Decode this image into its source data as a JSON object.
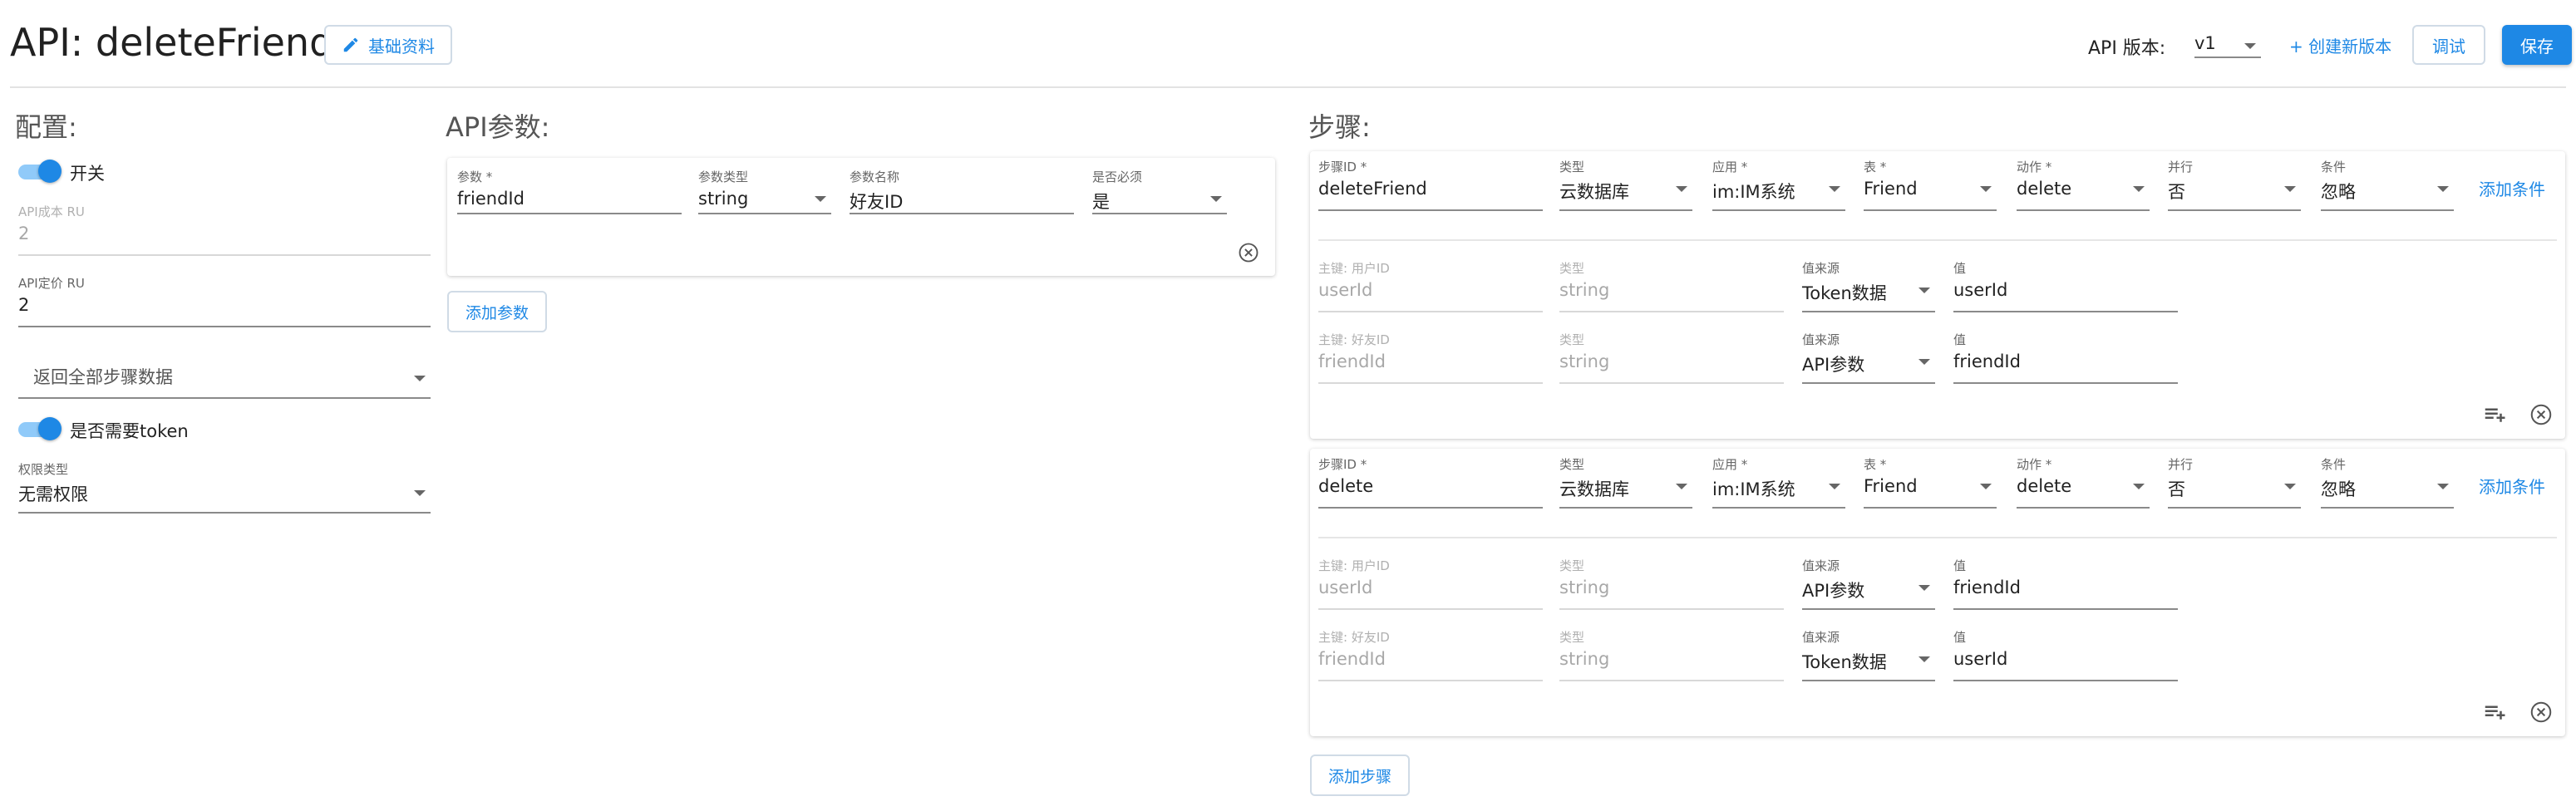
{
  "header": {
    "title": "API: deleteFriend",
    "basic_info_label": "基础资料",
    "api_version_label": "API 版本:",
    "api_version_value": "v1",
    "create_version_label": "+ 创建新版本",
    "debug_label": "调试",
    "save_label": "保存"
  },
  "config": {
    "heading": "配置:",
    "switch_label": "开关",
    "api_cost_label": "API成本 RU",
    "api_cost_value": "2",
    "api_price_label": "API定价 RU",
    "api_price_value": "2",
    "return_select_placeholder": "返回全部步骤数据",
    "token_label": "是否需要token",
    "permission_label": "权限类型",
    "permission_value": "无需权限"
  },
  "params": {
    "heading": "API参数:",
    "items": [
      {
        "param_label": "参数 *",
        "param_value": "friendId",
        "type_label": "参数类型",
        "type_value": "string",
        "name_label": "参数名称",
        "name_value": "好友ID",
        "required_label": "是否必须",
        "required_value": "是"
      }
    ],
    "add_label": "添加参数"
  },
  "steps": {
    "heading": "步骤:",
    "items": [
      {
        "step_id_label": "步骤ID *",
        "step_id_value": "deleteFriend",
        "type_label": "类型",
        "type_value": "云数据库",
        "app_label": "应用 *",
        "app_value": "im:IM系统",
        "table_label": "表 *",
        "table_value": "Friend",
        "action_label": "动作 *",
        "action_value": "delete",
        "parallel_label": "并行",
        "parallel_value": "否",
        "condition_label": "条件",
        "condition_value": "忽略",
        "add_condition_label": "添加条件",
        "keys": [
          {
            "key_label": "主键: 用户ID",
            "key_value": "userId",
            "ktype_label": "类型",
            "ktype_value": "string",
            "source_label": "值来源",
            "source_value": "Token数据",
            "value_label": "值",
            "value_value": "userId"
          },
          {
            "key_label": "主键: 好友ID",
            "key_value": "friendId",
            "ktype_label": "类型",
            "ktype_value": "string",
            "source_label": "值来源",
            "source_value": "API参数",
            "value_label": "值",
            "value_value": "friendId"
          }
        ]
      },
      {
        "step_id_label": "步骤ID *",
        "step_id_value": "delete",
        "type_label": "类型",
        "type_value": "云数据库",
        "app_label": "应用 *",
        "app_value": "im:IM系统",
        "table_label": "表 *",
        "table_value": "Friend",
        "action_label": "动作 *",
        "action_value": "delete",
        "parallel_label": "并行",
        "parallel_value": "否",
        "condition_label": "条件",
        "condition_value": "忽略",
        "add_condition_label": "添加条件",
        "keys": [
          {
            "key_label": "主键: 用户ID",
            "key_value": "userId",
            "ktype_label": "类型",
            "ktype_value": "string",
            "source_label": "值来源",
            "source_value": "API参数",
            "value_label": "值",
            "value_value": "friendId"
          },
          {
            "key_label": "主键: 好友ID",
            "key_value": "friendId",
            "ktype_label": "类型",
            "ktype_value": "string",
            "source_label": "值来源",
            "source_value": "Token数据",
            "value_label": "值",
            "value_value": "userId"
          }
        ]
      }
    ],
    "add_step_label": "添加步骤"
  },
  "colors": {
    "accent": "#1e88e5",
    "accent_light": "#90caf9"
  },
  "icons": [
    "pencil-icon",
    "playlist-add-icon",
    "close-circle-icon",
    "chevron-down-icon"
  ]
}
